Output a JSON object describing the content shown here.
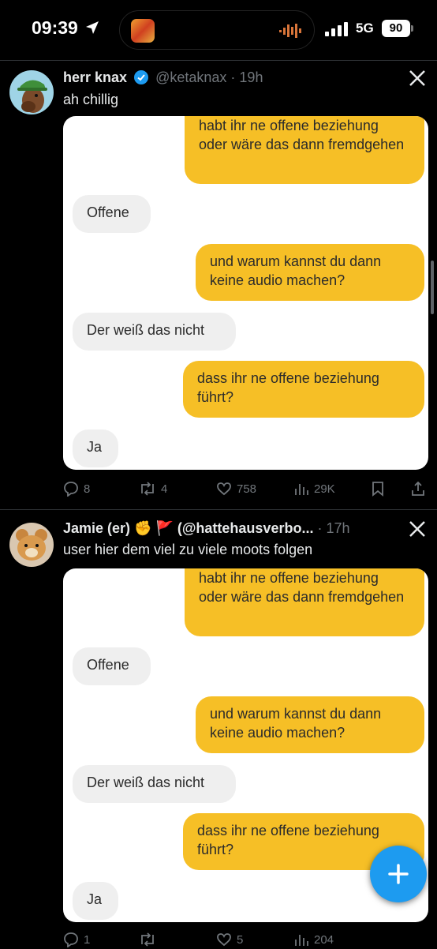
{
  "status": {
    "time": "09:39",
    "network": "5G",
    "battery": "90"
  },
  "tweets": [
    {
      "name": "herr knax",
      "verified": true,
      "handle": "@ketaknax",
      "age": "· 19h",
      "text": "ah chillig",
      "messages": [
        {
          "side": "out",
          "text": "habt ihr ne offene beziehung oder wäre das dann fremdgehen"
        },
        {
          "side": "in",
          "text": "Offene"
        },
        {
          "side": "out",
          "text": "und warum kannst du dann keine audio machen?"
        },
        {
          "side": "in",
          "text": "Der weiß das nicht"
        },
        {
          "side": "out",
          "text": "dass ihr ne offene beziehung führt?"
        },
        {
          "side": "in",
          "text": "Ja"
        }
      ],
      "stats": {
        "replies": "8",
        "reposts": "4",
        "likes": "758",
        "views": "29K"
      }
    },
    {
      "name": "Jamie (er) ✊ 🚩 (@hattehausverbo...",
      "handle": "",
      "age": "· 17h",
      "text": "user hier dem viel zu viele moots folgen",
      "messages": [
        {
          "side": "out",
          "text": "habt ihr ne offene beziehung oder wäre das dann fremdgehen"
        },
        {
          "side": "in",
          "text": "Offene"
        },
        {
          "side": "out",
          "text": "und warum kannst du dann keine audio machen?"
        },
        {
          "side": "in",
          "text": "Der weiß das nicht"
        },
        {
          "side": "out",
          "text": "dass ihr ne offene beziehung führt?"
        },
        {
          "side": "in",
          "text": "Ja"
        }
      ],
      "stats": {
        "replies": "1",
        "reposts": "",
        "likes": "5",
        "views": "204"
      }
    }
  ],
  "colors": {
    "background": "#000000",
    "bubble_out": "#f6bf26",
    "bubble_in": "#efefef",
    "accent": "#1d9bf0",
    "verified": "#1d9bf0",
    "muted": "#71767b"
  },
  "icons": [
    "location-arrow-icon",
    "audio-wave-icon",
    "signal-icon",
    "verified-badge-icon",
    "x-logo-icon",
    "reply-icon",
    "repost-icon",
    "like-icon",
    "views-icon",
    "bookmark-icon",
    "share-icon",
    "plus-icon"
  ]
}
